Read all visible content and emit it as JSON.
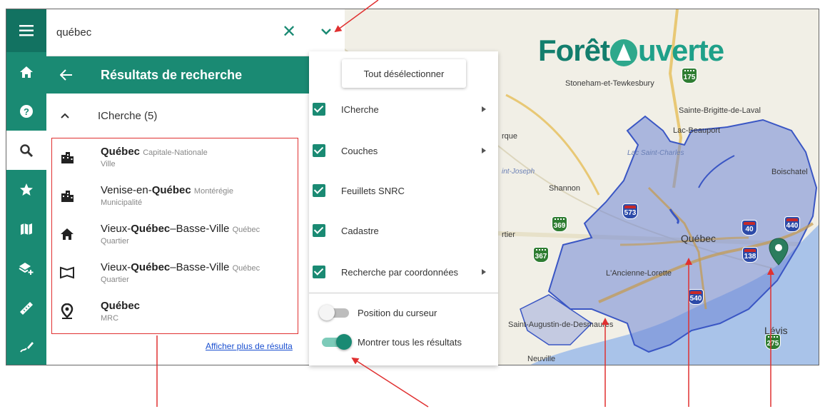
{
  "app": {
    "brand_part1": "Forêt",
    "brand_part2": "uverte"
  },
  "rail": {
    "items": [
      {
        "icon": "menu-icon"
      },
      {
        "icon": "home-icon"
      },
      {
        "icon": "help-icon"
      },
      {
        "icon": "search-icon",
        "active": true
      },
      {
        "icon": "star-icon"
      },
      {
        "icon": "map-icon"
      },
      {
        "icon": "layers-add-icon"
      },
      {
        "icon": "ruler-icon"
      },
      {
        "icon": "draw-icon"
      }
    ]
  },
  "search": {
    "value": "québec",
    "clear_icon": "✕"
  },
  "results": {
    "title": "Résultats de recherche",
    "group_label": "ICherche (5)",
    "items": [
      {
        "icon": "city-icon",
        "name": "Québec",
        "region": "Capitale-Nationale",
        "type": "Ville"
      },
      {
        "icon": "city-icon",
        "name_pre": "Venise-en-",
        "name": "Québec",
        "region": "Montérégie",
        "type": "Municipalité"
      },
      {
        "icon": "house-icon",
        "name_pre": "Vieux-",
        "name": "Québec",
        "name_post": "–Basse-Ville",
        "region": "Québec",
        "type": "Quartier"
      },
      {
        "icon": "area-icon",
        "name_pre": "Vieux-",
        "name": "Québec",
        "name_post": "–Basse-Ville",
        "region": "Québec",
        "type": "Quartier"
      },
      {
        "icon": "pin-icon",
        "name": "Québec",
        "region": "",
        "type": "MRC"
      }
    ],
    "more_link": "Afficher plus de résulta"
  },
  "filter": {
    "deselect_label": "Tout désélectionner",
    "options": [
      {
        "label": "ICherche",
        "checked": true,
        "submenu": true
      },
      {
        "label": "Couches",
        "checked": true,
        "submenu": true
      },
      {
        "label": "Feuillets SNRC",
        "checked": true,
        "submenu": false
      },
      {
        "label": "Cadastre",
        "checked": true,
        "submenu": false
      },
      {
        "label": "Recherche par coordonnées",
        "checked": true,
        "submenu": true
      }
    ],
    "toggles": [
      {
        "label": "Position du curseur",
        "on": false
      },
      {
        "label": "Montrer tous les résultats",
        "on": true
      }
    ]
  },
  "map": {
    "places": [
      "Stoneham-et-Tewkesbury",
      "Sainte-Brigitte-de-Laval",
      "Lac-Beauport",
      "Boischatel",
      "Shannon",
      "Québec",
      "L'Ancienne-Lorette",
      "Saint-Augustin-de-Desmaures",
      "Lévis",
      "Neuville",
      "rtier",
      "rque"
    ],
    "water": [
      "Lac Saint-Charles",
      "int-Joseph"
    ],
    "highways": [
      {
        "num": "175",
        "style": "green"
      },
      {
        "num": "573",
        "style": "blue"
      },
      {
        "num": "369",
        "style": "green"
      },
      {
        "num": "367",
        "style": "green"
      },
      {
        "num": "40",
        "style": "blue"
      },
      {
        "num": "440",
        "style": "blue"
      },
      {
        "num": "138",
        "style": "blue"
      },
      {
        "num": "540",
        "style": "blue"
      },
      {
        "num": "275",
        "style": "green"
      }
    ]
  },
  "colors": {
    "accent": "#1a8a73",
    "annotation": "#e03030",
    "polygon": "#6f86d6"
  }
}
